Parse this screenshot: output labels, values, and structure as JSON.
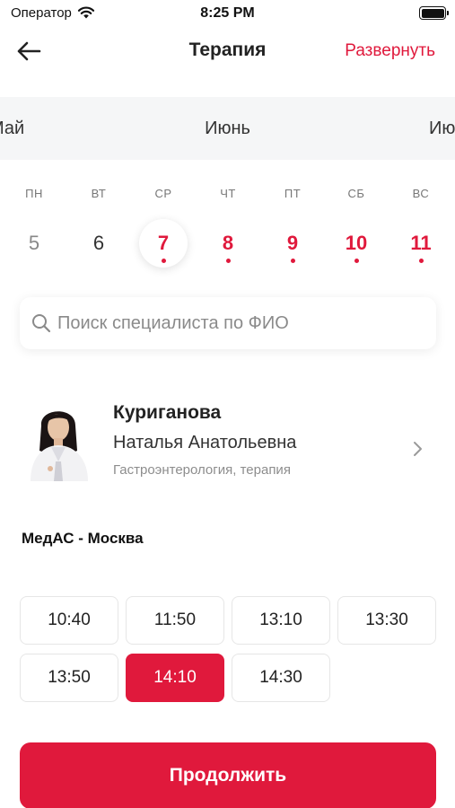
{
  "status_bar": {
    "carrier": "Оператор",
    "time": "8:25 PM",
    "wifi_icon": "wifi-icon",
    "battery_icon": "battery-icon"
  },
  "nav": {
    "back_icon": "arrow-left-icon",
    "title": "Терапия",
    "expand_label": "Развернуть"
  },
  "months": {
    "prev": "Май",
    "current": "Июнь",
    "next": "Июль"
  },
  "week": {
    "days": [
      {
        "dow": "ПН",
        "num": "5",
        "state": "past"
      },
      {
        "dow": "ВТ",
        "num": "6",
        "state": "normal"
      },
      {
        "dow": "СР",
        "num": "7",
        "state": "selected"
      },
      {
        "dow": "ЧТ",
        "num": "8",
        "state": "available"
      },
      {
        "dow": "ПТ",
        "num": "9",
        "state": "available"
      },
      {
        "dow": "СБ",
        "num": "10",
        "state": "available"
      },
      {
        "dow": "ВС",
        "num": "11",
        "state": "available"
      }
    ]
  },
  "search": {
    "placeholder": "Поиск специалиста по ФИО",
    "value": ""
  },
  "doctor": {
    "surname": "Куриганова",
    "name": "Наталья Анатольевна",
    "specialty": "Гастроэнтерология, терапия"
  },
  "clinic": {
    "name": "МедАС - Москва"
  },
  "slots": [
    {
      "time": "10:40",
      "selected": false
    },
    {
      "time": "11:50",
      "selected": false
    },
    {
      "time": "13:10",
      "selected": false
    },
    {
      "time": "13:30",
      "selected": false
    },
    {
      "time": "13:50",
      "selected": false
    },
    {
      "time": "14:10",
      "selected": true
    },
    {
      "time": "14:30",
      "selected": false
    }
  ],
  "continue_label": "Продолжить",
  "colors": {
    "accent": "#e0193c",
    "month_strip_bg": "#f5f6f7",
    "muted_text": "#8d8d8d"
  }
}
